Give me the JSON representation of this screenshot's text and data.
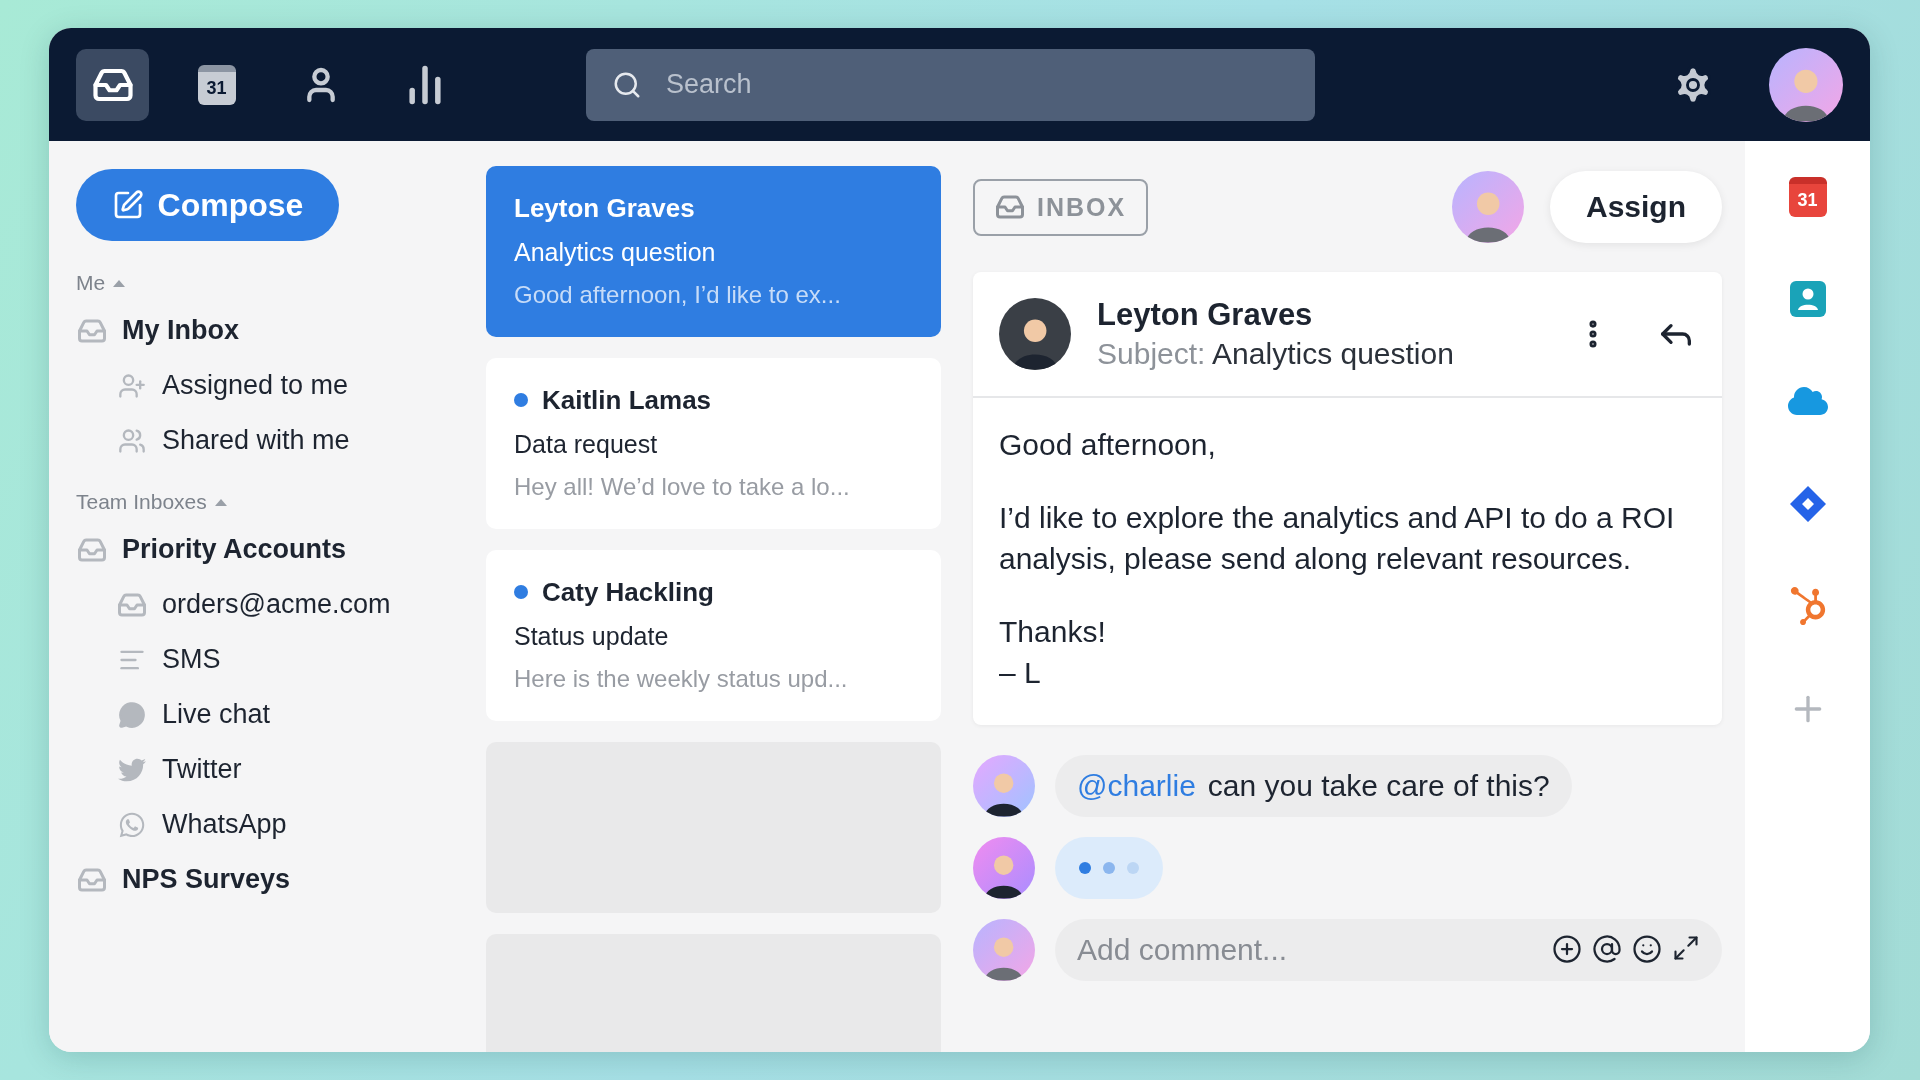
{
  "topbar": {
    "nav": [
      {
        "kind": "inbox",
        "selected": true
      },
      {
        "kind": "calendar",
        "label": "31",
        "selected": false
      },
      {
        "kind": "contacts",
        "selected": false
      },
      {
        "kind": "analytics",
        "selected": false
      }
    ],
    "search": {
      "placeholder": "Search"
    }
  },
  "sidebar": {
    "compose": "Compose",
    "sections": [
      {
        "title": "Me",
        "expanded": true,
        "items": [
          {
            "kind": "inbox",
            "label": "My Inbox",
            "children": [
              {
                "kind": "assigned",
                "label": "Assigned to me"
              },
              {
                "kind": "shared",
                "label": "Shared with me"
              }
            ]
          }
        ]
      },
      {
        "title": "Team Inboxes",
        "expanded": true,
        "items": [
          {
            "kind": "inbox",
            "label": "Priority Accounts",
            "children": [
              {
                "kind": "inbox",
                "label": "orders@acme.com"
              },
              {
                "kind": "sms",
                "label": "SMS"
              },
              {
                "kind": "chat",
                "label": "Live chat"
              },
              {
                "kind": "twitter",
                "label": "Twitter"
              },
              {
                "kind": "whatsapp",
                "label": "WhatsApp"
              }
            ]
          },
          {
            "kind": "inbox",
            "label": "NPS Surveys"
          }
        ]
      }
    ]
  },
  "conversations": [
    {
      "name": "Leyton Graves",
      "subject": "Analytics question",
      "preview": "Good afternoon, I’d like to ex...",
      "selected": true,
      "unread": false
    },
    {
      "name": "Kaitlin Lamas",
      "subject": "Data request",
      "preview": "Hey all! We’d love to take a lo...",
      "selected": false,
      "unread": true
    },
    {
      "name": "Caty Hackling",
      "subject": "Status update",
      "preview": "Here is the weekly status upd...",
      "selected": false,
      "unread": true
    }
  ],
  "detail": {
    "tag": "INBOX",
    "assign": "Assign",
    "message": {
      "sender": "Leyton Graves",
      "subject_label": "Subject:",
      "subject": "Analytics question",
      "body": [
        [
          "Good afternoon,"
        ],
        [
          "I’d like to explore the analytics and API to do a ROI analysis, please send along relevant resources."
        ],
        [
          "Thanks!",
          "– L"
        ]
      ]
    },
    "comments": [
      {
        "kind": "text",
        "mention": "@charlie",
        "text": "can you take care of this?"
      },
      {
        "kind": "typing"
      }
    ],
    "comment_box": {
      "placeholder": "Add comment..."
    }
  },
  "rail": [
    {
      "kind": "calendar",
      "label": "31"
    },
    {
      "kind": "contact"
    },
    {
      "kind": "cloud"
    },
    {
      "kind": "diamond"
    },
    {
      "kind": "hub"
    },
    {
      "kind": "add"
    }
  ]
}
